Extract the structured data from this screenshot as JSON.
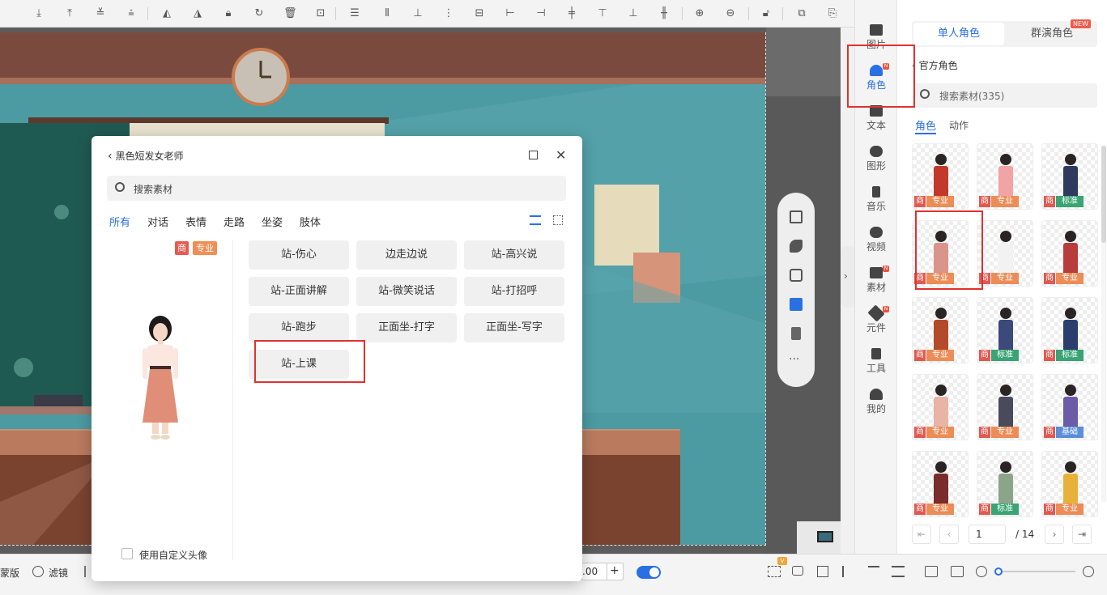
{
  "dialog": {
    "title": "黑色短发女老师",
    "search_placeholder": "搜索素材",
    "categories": [
      "所有",
      "对话",
      "表情",
      "走路",
      "坐姿",
      "肢体"
    ],
    "badge_shang": "商",
    "badge_level": "专业",
    "actions": [
      "站-伤心",
      "边走边说",
      "站-高兴说",
      "站-正面讲解",
      "站-微笑说话",
      "站-打招呼",
      "站-跑步",
      "正面坐-打字",
      "正面坐-写字",
      "站-上课"
    ],
    "custom_avatar_label": "使用自定义头像"
  },
  "iconbar": {
    "items": [
      {
        "label": "图片",
        "icon": "image-icon"
      },
      {
        "label": "角色",
        "icon": "person-icon",
        "badge": "N"
      },
      {
        "label": "文本",
        "icon": "text-icon"
      },
      {
        "label": "图形",
        "icon": "shapes-icon"
      },
      {
        "label": "音乐",
        "icon": "music-icon"
      },
      {
        "label": "视频",
        "icon": "video-icon"
      },
      {
        "label": "素材",
        "icon": "folder-icon",
        "badge": "N"
      },
      {
        "label": "元件",
        "icon": "pinwheel-icon",
        "badge": "N"
      },
      {
        "label": "工具",
        "icon": "wrench-icon"
      },
      {
        "label": "我的",
        "icon": "user-icon"
      }
    ]
  },
  "panel": {
    "tab_single": "单人角色",
    "tab_group": "群演角色",
    "new_badge": "NEW",
    "back_label": "官方角色",
    "search_placeholder": "搜索素材(335)",
    "subtab_role": "角色",
    "subtab_action": "动作",
    "thumb_shang": "商",
    "thumbs": [
      {
        "level": "专业",
        "color": "#c0392b"
      },
      {
        "level": "专业",
        "color": "#f2a3a3"
      },
      {
        "level": "标准",
        "color": "#2e3b5e"
      },
      {
        "level": "专业",
        "color": "#d9958a"
      },
      {
        "level": "专业",
        "color": "#f2f2f2"
      },
      {
        "level": "专业",
        "color": "#b83c3c"
      },
      {
        "level": "专业",
        "color": "#b34a2a"
      },
      {
        "level": "标准",
        "color": "#3b4a7a"
      },
      {
        "level": "标准",
        "color": "#2a3f6e"
      },
      {
        "level": "专业",
        "color": "#e7b4a6"
      },
      {
        "level": "专业",
        "color": "#4a4a5c"
      },
      {
        "level": "基础",
        "color": "#6b5ca8"
      },
      {
        "level": "专业",
        "color": "#7a2b2b"
      },
      {
        "level": "标准",
        "color": "#8aa58a"
      },
      {
        "level": "专业",
        "color": "#e8b23a"
      }
    ],
    "pager": {
      "current": "1",
      "total": "/ 14"
    }
  },
  "bottombar": {
    "mask_label": "蒙版",
    "filter_label": "滤镜",
    "zoom_value": ".00",
    "plus_label": "+"
  }
}
